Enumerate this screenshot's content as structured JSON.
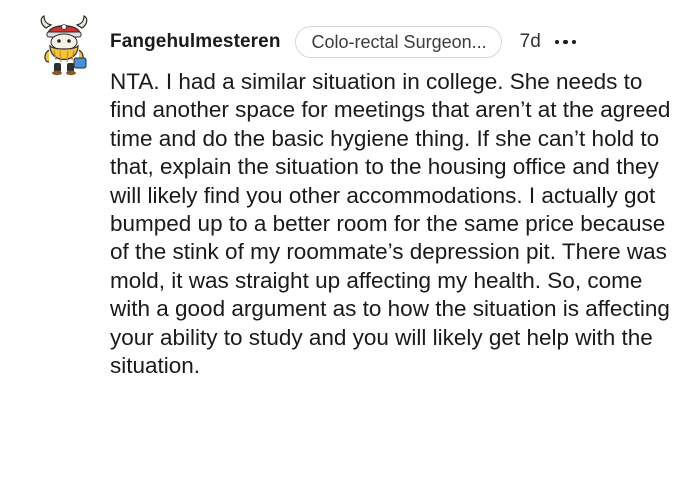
{
  "comment": {
    "username": "Fangehulmesteren",
    "flair": "Colo-rectal Surgeon...",
    "timestamp": "7d",
    "avatar_icon": "viking-snoo-avatar-icon",
    "more_icon": "more-options-icon",
    "body": "NTA. I had a similar situation in college. She needs to find another space for meetings that aren’t at the agreed time and do the basic hygiene thing. If she can’t hold to that, explain the situation to the housing office and they will likely find you other accommodations. I actually got bumped up to a better room for the same price because of the stink of my roommate’s depression pit. There was mold, it was straight up affecting my health. So, come with a good argument as to how the situation is affecting your ability to study and you will likely get help with the situation."
  },
  "colors": {
    "text": "#1a1a1b",
    "flair_border": "#d4d7da",
    "avatar_gold": "#f3c33b",
    "avatar_red": "#d1342f"
  }
}
